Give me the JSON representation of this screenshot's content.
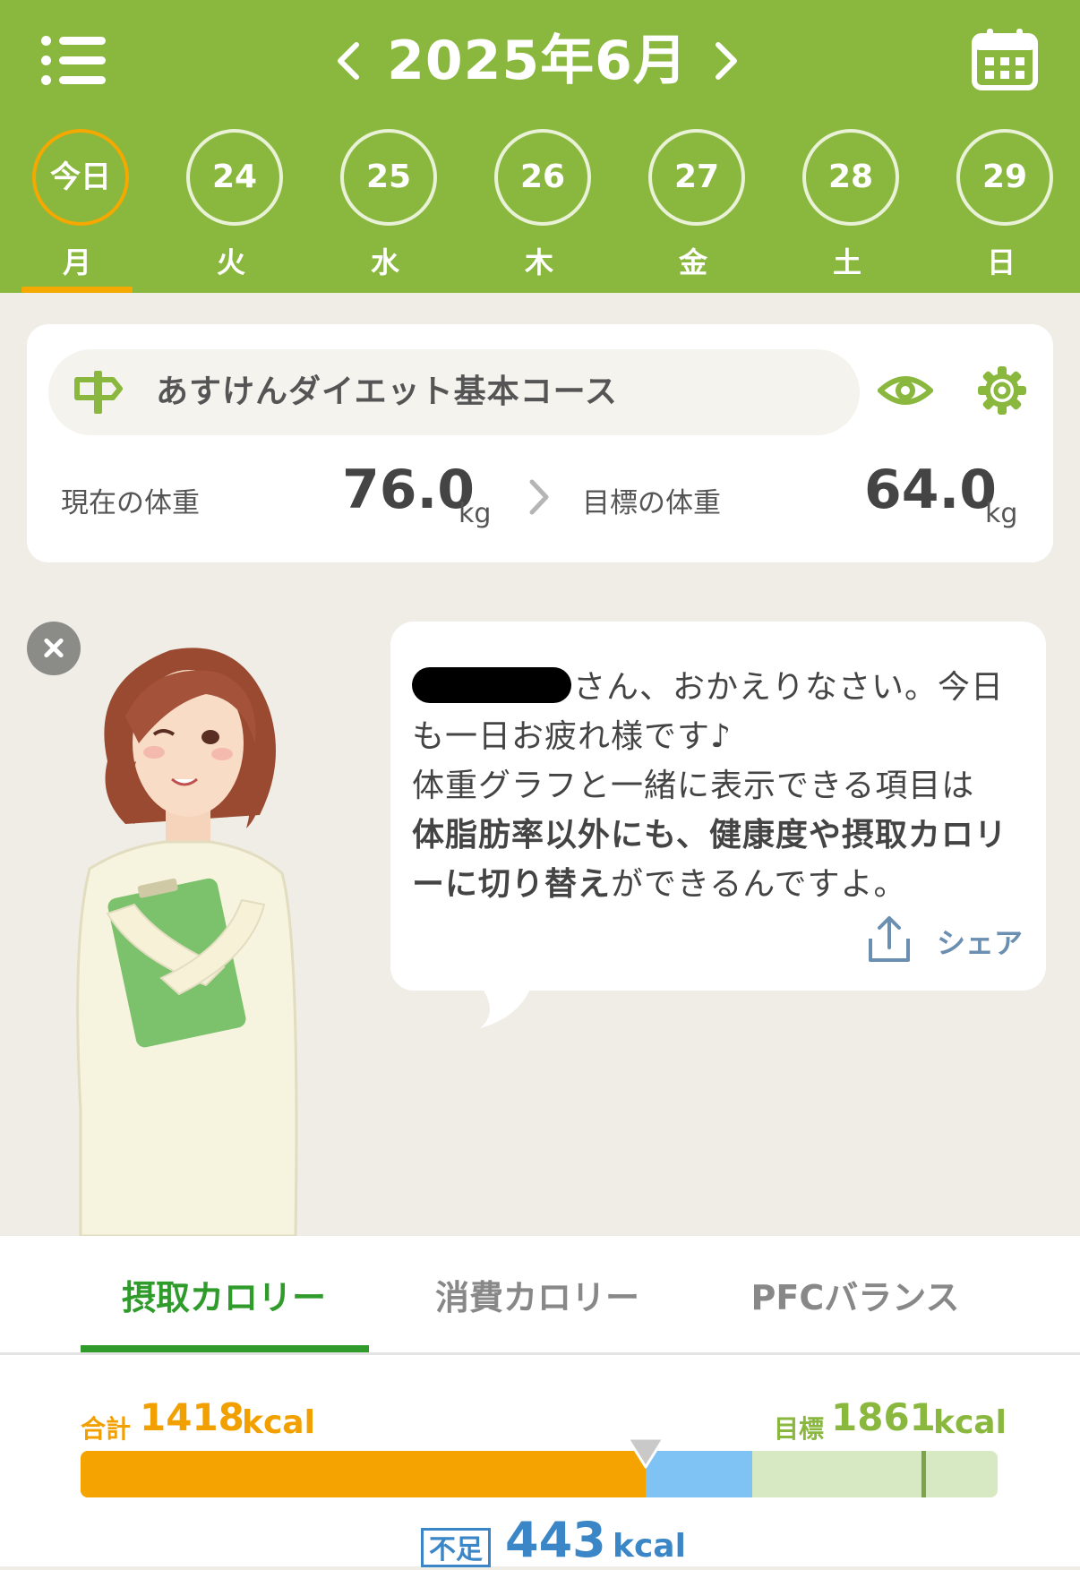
{
  "header": {
    "month_title": "2025年6月",
    "prev_label": "‹",
    "next_label": "›"
  },
  "days": [
    {
      "label": "今日",
      "weekday": "月",
      "today": true
    },
    {
      "label": "24",
      "weekday": "火"
    },
    {
      "label": "25",
      "weekday": "水"
    },
    {
      "label": "26",
      "weekday": "木"
    },
    {
      "label": "27",
      "weekday": "金"
    },
    {
      "label": "28",
      "weekday": "土"
    },
    {
      "label": "29",
      "weekday": "日"
    }
  ],
  "course": {
    "name": "あすけんダイエット基本コース",
    "current_label": "現在の体重",
    "current_value": "76.0",
    "target_label": "目標の体重",
    "target_value": "64.0",
    "unit": "kg"
  },
  "message": {
    "line1": "さん、おかえりなさい。今日も一日お疲れ様です♪",
    "line2": "体重グラフと一緒に表示できる項目は",
    "bold": "体脂肪率以外にも、健康度や摂取カロリーに切り替え",
    "line3": "ができるんですよ。",
    "share_label": "シェア"
  },
  "tabs": [
    "摂取カロリー",
    "消費カロリー",
    "PFCバランス"
  ],
  "calories": {
    "total_label": "合計",
    "total_value": "1418",
    "goal_label": "目標",
    "goal_value": "1861",
    "unit": "kcal",
    "deficit_label": "不足",
    "deficit_value": "443",
    "intake_kcal": 1418,
    "goal_kcal": 1861,
    "bar_max_kcal": 2300
  },
  "colors": {
    "header": "#8ab83e",
    "today_ring": "#f5a800",
    "intake": "#f5a300",
    "deficit": "#7fc2f4",
    "active_tab": "#2e9b2a"
  }
}
